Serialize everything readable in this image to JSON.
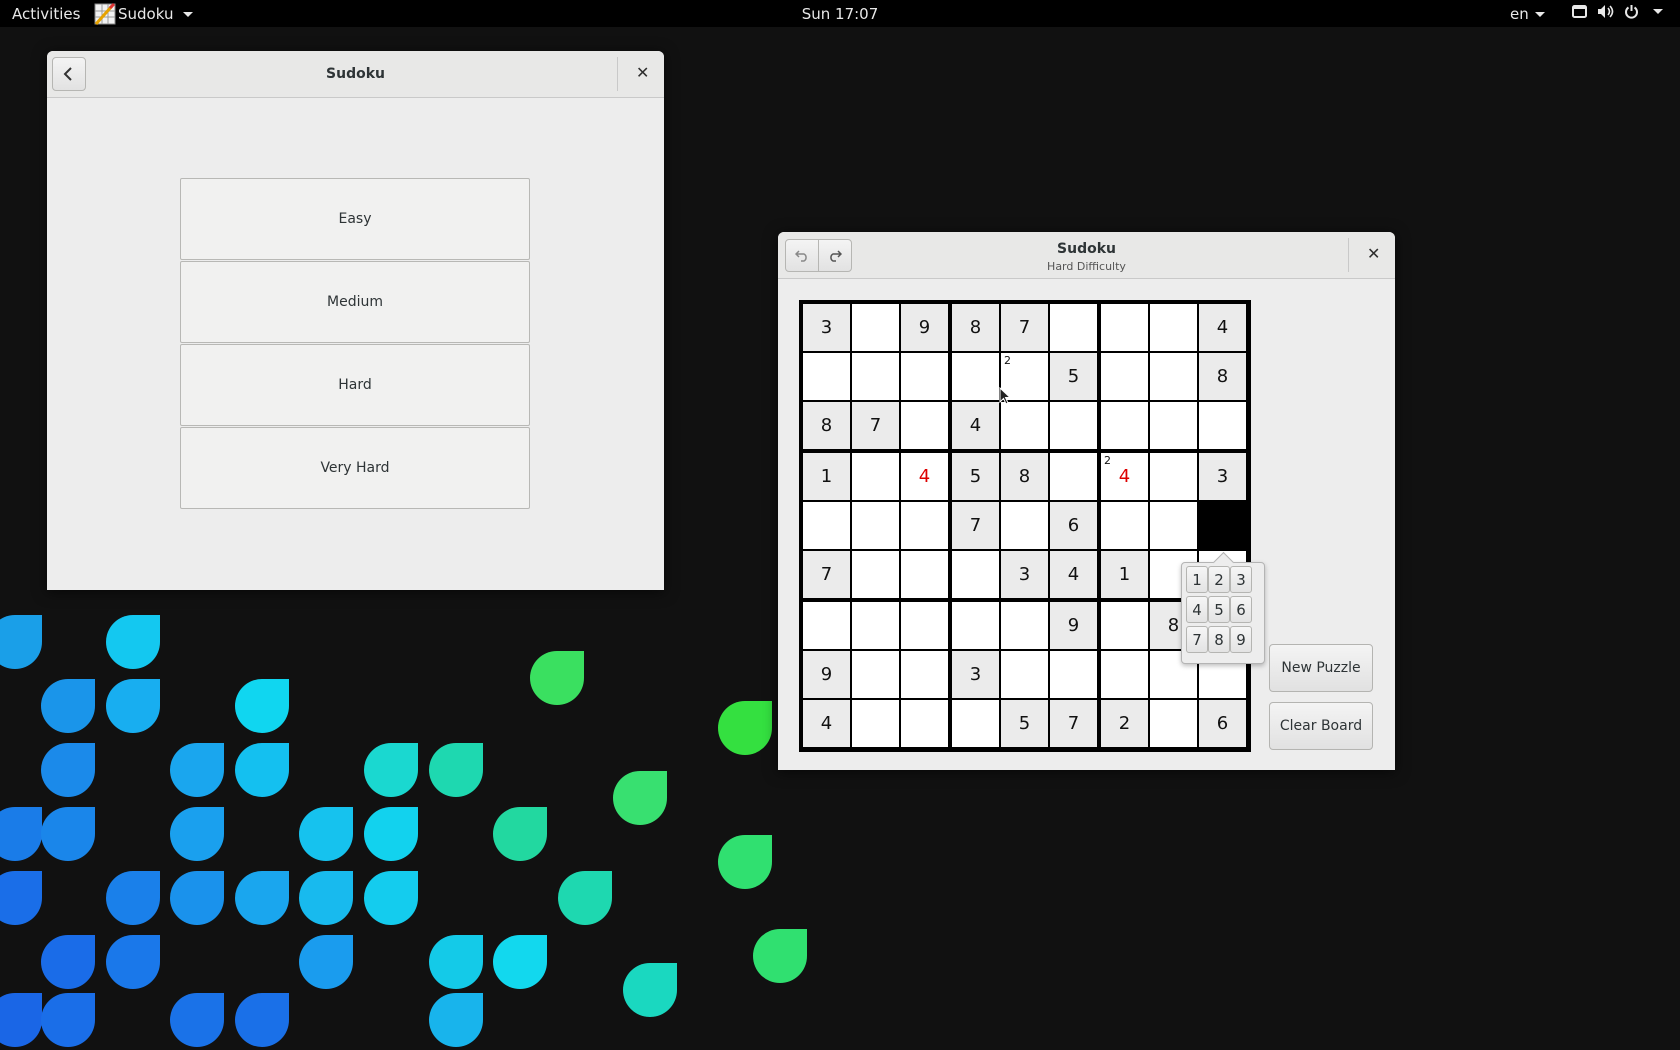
{
  "topbar": {
    "activities": "Activities",
    "app_menu": "Sudoku",
    "clock": "Sun 17:07",
    "language": "en",
    "tray_icons": [
      "screen-icon",
      "volume-icon",
      "power-icon"
    ]
  },
  "menu_window": {
    "title": "Sudoku",
    "back_icon": "chevron-left-icon",
    "close_icon": "close-icon",
    "difficulties": [
      "Easy",
      "Medium",
      "Hard",
      "Very Hard"
    ]
  },
  "game_window": {
    "title": "Sudoku",
    "subtitle": "Hard Difficulty",
    "undo_icon": "undo-icon",
    "redo_icon": "redo-icon",
    "close_icon": "close-icon",
    "new_puzzle": "New Puzzle",
    "clear_board": "Clear Board",
    "popover_numbers": [
      "1",
      "2",
      "3",
      "4",
      "5",
      "6",
      "7",
      "8",
      "9"
    ],
    "board": [
      [
        "3",
        "",
        "9",
        "8",
        "7",
        "",
        "",
        "",
        "4"
      ],
      [
        "",
        "",
        "",
        "",
        "",
        "5",
        "",
        "",
        "8"
      ],
      [
        "8",
        "7",
        "",
        "4",
        "",
        "",
        "",
        "",
        ""
      ],
      [
        "1",
        "",
        "4",
        "5",
        "8",
        "",
        "4",
        "",
        "3"
      ],
      [
        "",
        "",
        "",
        "7",
        "",
        "6",
        "",
        "",
        ""
      ],
      [
        "7",
        "",
        "",
        "",
        "3",
        "4",
        "1",
        "",
        ""
      ],
      [
        "",
        "",
        "",
        "",
        "",
        "9",
        "",
        "8",
        ""
      ],
      [
        "9",
        "",
        "",
        "3",
        "",
        "",
        "",
        "",
        ""
      ],
      [
        "4",
        "",
        "",
        "",
        "5",
        "7",
        "2",
        "",
        "6"
      ]
    ],
    "fixed": [
      [
        1,
        0,
        1,
        1,
        1,
        0,
        0,
        0,
        1
      ],
      [
        0,
        0,
        0,
        0,
        0,
        1,
        0,
        0,
        1
      ],
      [
        1,
        1,
        0,
        1,
        0,
        0,
        0,
        0,
        0
      ],
      [
        1,
        0,
        0,
        1,
        1,
        0,
        0,
        0,
        1
      ],
      [
        0,
        0,
        0,
        1,
        0,
        1,
        0,
        0,
        0
      ],
      [
        1,
        0,
        0,
        0,
        1,
        1,
        1,
        0,
        0
      ],
      [
        0,
        0,
        0,
        0,
        0,
        1,
        0,
        1,
        0
      ],
      [
        1,
        0,
        0,
        1,
        0,
        0,
        0,
        0,
        0
      ],
      [
        1,
        0,
        0,
        0,
        1,
        1,
        1,
        0,
        1
      ]
    ],
    "errors": [
      [
        3,
        2
      ],
      [
        3,
        6
      ]
    ],
    "notes": [
      {
        "row": 1,
        "col": 4,
        "text": "2"
      },
      {
        "row": 3,
        "col": 6,
        "text": "2"
      }
    ],
    "selected": [
      4,
      8
    ]
  },
  "colors": {
    "error": "#dd0000",
    "fixed_cell": "#ebebeb",
    "selected_cell": "#000000"
  }
}
